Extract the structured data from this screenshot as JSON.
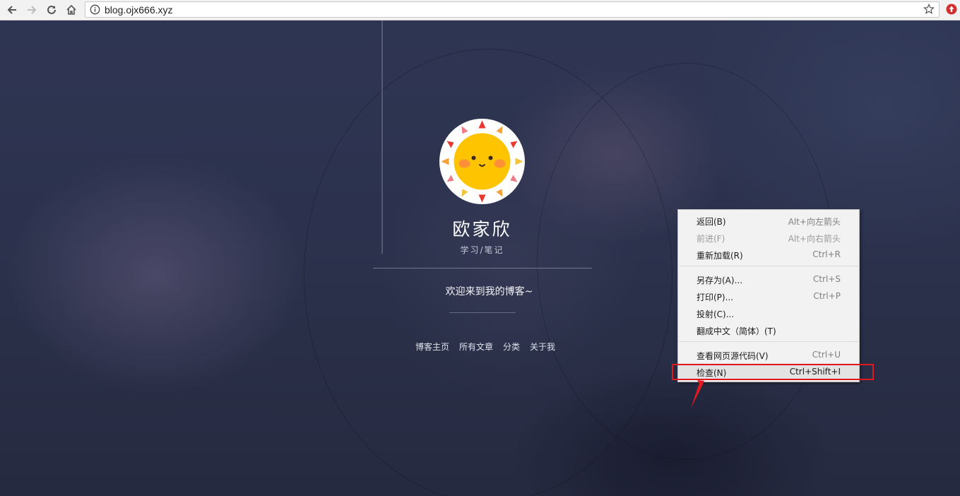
{
  "browser": {
    "url": "blog.ojx666.xyz",
    "icons": {
      "back": "back-arrow-icon",
      "forward": "forward-arrow-icon",
      "reload": "reload-icon",
      "home": "home-icon",
      "info": "info-icon",
      "bookmark": "star-icon",
      "extension": "extension-icon"
    }
  },
  "profile": {
    "title": "欧家欣",
    "subtitle": "学习/笔记",
    "welcome": "欢迎来到我的博客~"
  },
  "nav": {
    "home": "博客主页",
    "all_posts": "所有文章",
    "categories": "分类",
    "about": "关于我"
  },
  "context_menu": {
    "items": [
      {
        "label": "返回(B)",
        "shortcut": "Alt+向左箭头",
        "disabled": false
      },
      {
        "label": "前进(F)",
        "shortcut": "Alt+向右箭头",
        "disabled": true
      },
      {
        "label": "重新加载(R)",
        "shortcut": "Ctrl+R",
        "disabled": false
      },
      {
        "label": "另存为(A)...",
        "shortcut": "Ctrl+S",
        "disabled": false
      },
      {
        "label": "打印(P)...",
        "shortcut": "Ctrl+P",
        "disabled": false
      },
      {
        "label": "投射(C)...",
        "shortcut": "",
        "disabled": false
      },
      {
        "label": "翻成中文（简体）(T)",
        "shortcut": "",
        "disabled": false
      },
      {
        "label": "查看网页源代码(V)",
        "shortcut": "Ctrl+U",
        "disabled": false
      },
      {
        "label": "检查(N)",
        "shortcut": "Ctrl+Shift+I",
        "disabled": false,
        "highlighted": true
      }
    ]
  },
  "colors": {
    "annotation_red": "#e0191f",
    "menu_background": "#f2f2f2",
    "page_background": "#2c324d",
    "avatar_sun": "#ffc400"
  }
}
